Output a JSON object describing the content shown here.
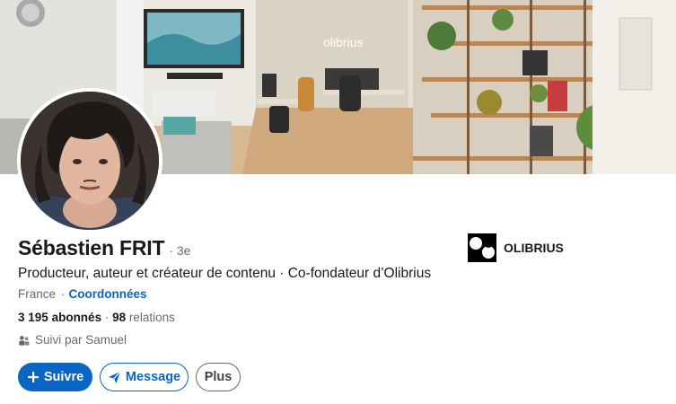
{
  "profile": {
    "name": "Sébastien FRIT",
    "degree": "· 3e",
    "headline": "Producteur, auteur et créateur de contenu · Co-fondateur d’Olibrius",
    "location": "France",
    "contact_label": "Coordonnées",
    "followers_count": "3 195",
    "followers_label": "abonnés",
    "connections_separator": "·",
    "connections_count": "98",
    "connections_label": "relations",
    "followed_by": "Suivi par Samuel"
  },
  "company": {
    "name": "OLIBRIUS"
  },
  "cover": {
    "wall_sign": "olibrius"
  },
  "actions": {
    "follow_label": "Suivre",
    "message_label": "Message",
    "more_label": "Plus"
  },
  "colors": {
    "accent": "#0a66c2",
    "text": "#191919",
    "muted": "#666666"
  },
  "icons": [
    "plus-icon",
    "send-icon",
    "people-icon"
  ]
}
